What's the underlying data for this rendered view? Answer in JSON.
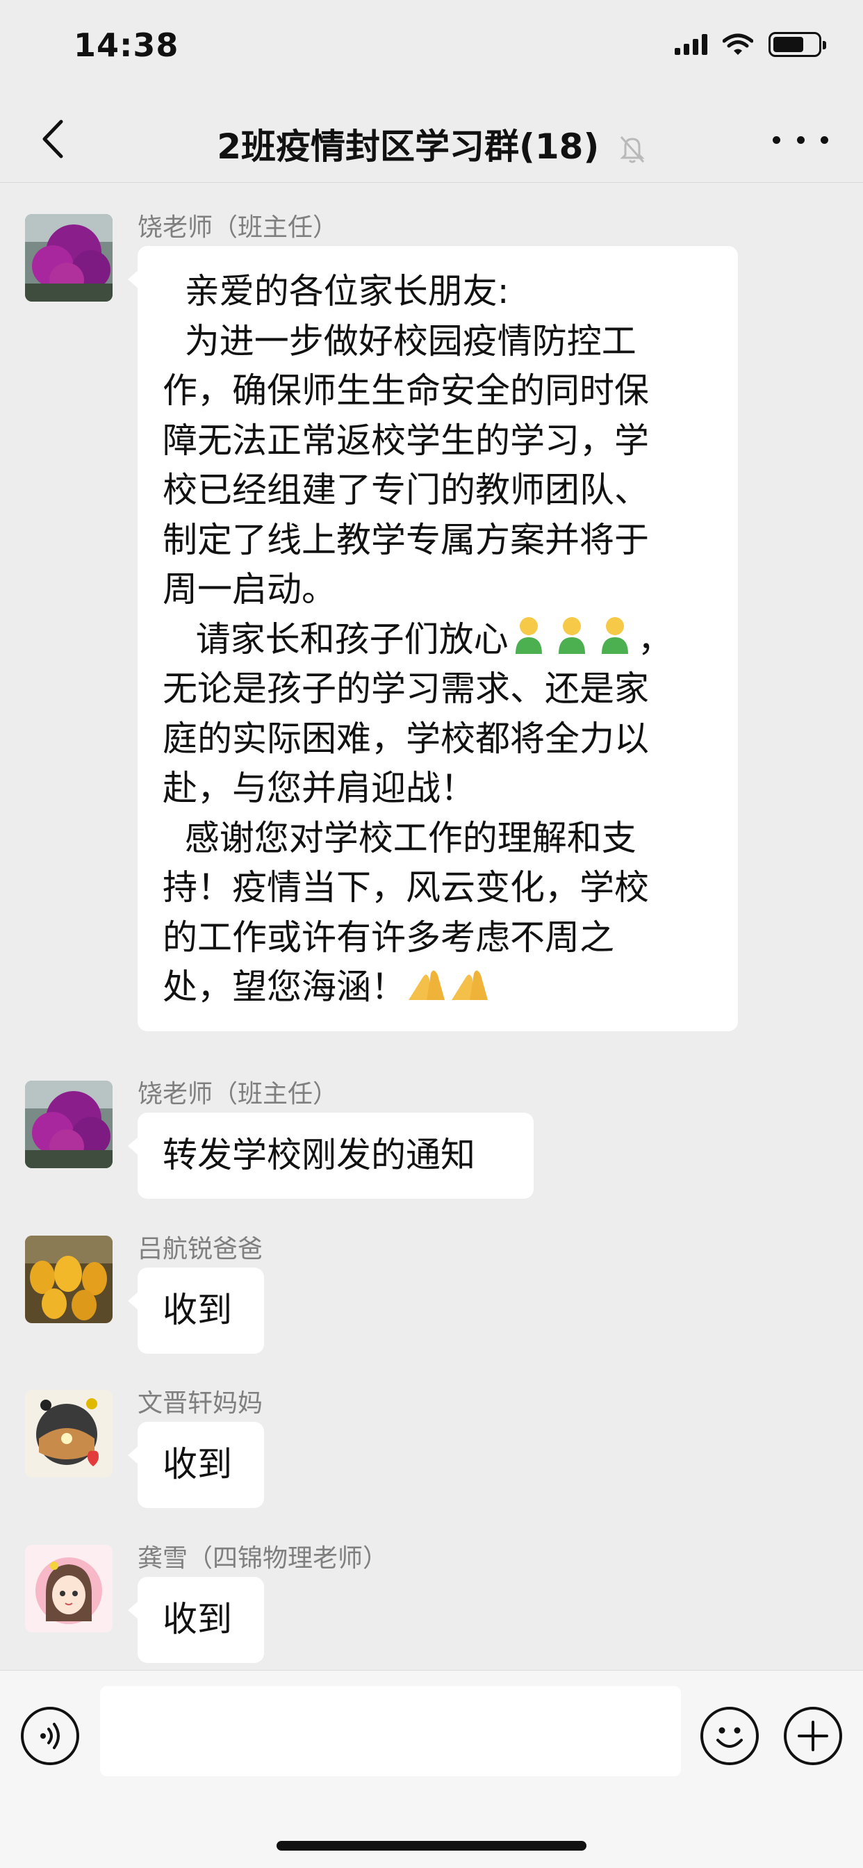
{
  "status_bar": {
    "time": "14:38"
  },
  "header": {
    "title": "2班疫情封区学习群(18)"
  },
  "messages": [
    {
      "sender": "饶老师（班主任）",
      "lines": [
        "  亲爱的各位家长朋友:",
        "  为进一步做好校园疫情防控工",
        "作，确保师生生命安全的同时保",
        "障无法正常返校学生的学习，学",
        "校已经组建了专门的教师团队、",
        "制定了线上教学专属方案并将于",
        "周一启动。",
        "   请家长和孩子们放心",
        "无论是孩子的学习需求、还是家",
        "庭的实际困难，学校都将全力以",
        "赴，与您并肩迎战！",
        "  感谢您对学校工作的理解和支",
        "持！疫情当下，风云变化，学校",
        "的工作或许有许多考虑不周之",
        "处，望您海涵！"
      ],
      "line8_suffix": "，"
    },
    {
      "sender": "饶老师（班主任）",
      "text": "转发学校刚发的通知"
    },
    {
      "sender": "吕航锐爸爸",
      "text": "收到"
    },
    {
      "sender": "文晋轩妈妈",
      "text": "收到"
    },
    {
      "sender": "龚雪（四锦物理老师）",
      "text": "收到"
    }
  ],
  "icons": {
    "back": "chevron-left-icon",
    "mute": "bell-slash-icon",
    "more": "more-icon",
    "voice": "voice-icon",
    "emoji": "emoji-icon",
    "plus": "plus-icon"
  },
  "colors": {
    "background": "#ededed",
    "bubble": "#ffffff",
    "sender_name": "#7f7f7f"
  }
}
